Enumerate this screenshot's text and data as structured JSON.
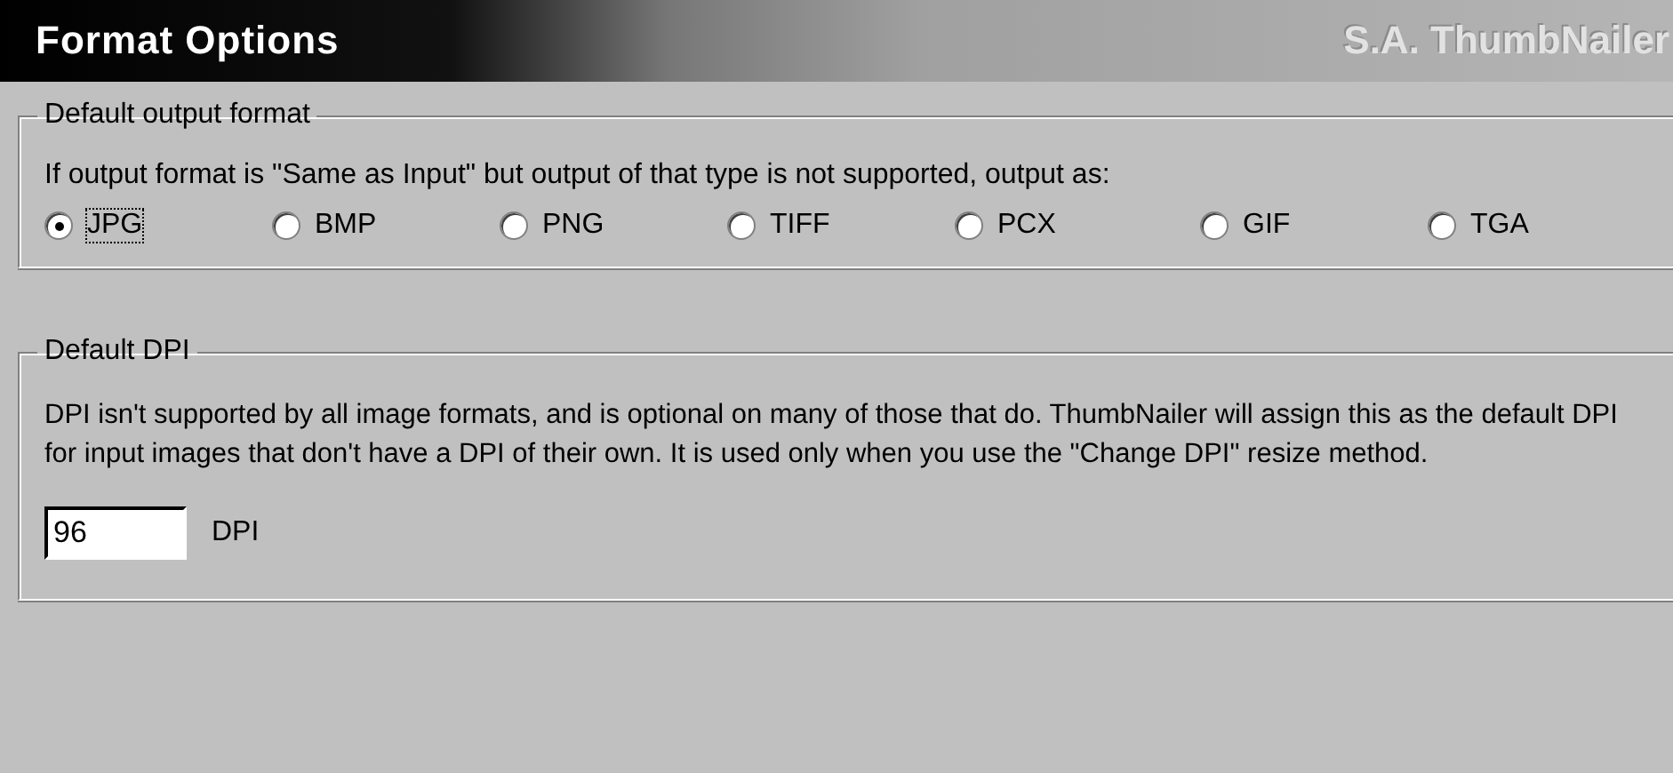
{
  "header": {
    "title": "Format Options",
    "brand": "S.A. ThumbNailer"
  },
  "output_format": {
    "legend": "Default output format",
    "description": "If output format is \"Same as Input\" but output of that type is not supported, output as:",
    "options": [
      {
        "label": "JPG",
        "selected": true
      },
      {
        "label": "BMP",
        "selected": false
      },
      {
        "label": "PNG",
        "selected": false
      },
      {
        "label": "TIFF",
        "selected": false
      },
      {
        "label": "PCX",
        "selected": false
      },
      {
        "label": "GIF",
        "selected": false
      },
      {
        "label": "TGA",
        "selected": false
      }
    ]
  },
  "dpi": {
    "legend": "Default DPI",
    "description": "DPI isn't supported by all image formats, and is optional on many of those that do. ThumbNailer will assign this as the default DPI for input images that don't have a DPI of their own. It is used only when you use the \"Change DPI\" resize method.",
    "value": "96",
    "unit": "DPI"
  }
}
